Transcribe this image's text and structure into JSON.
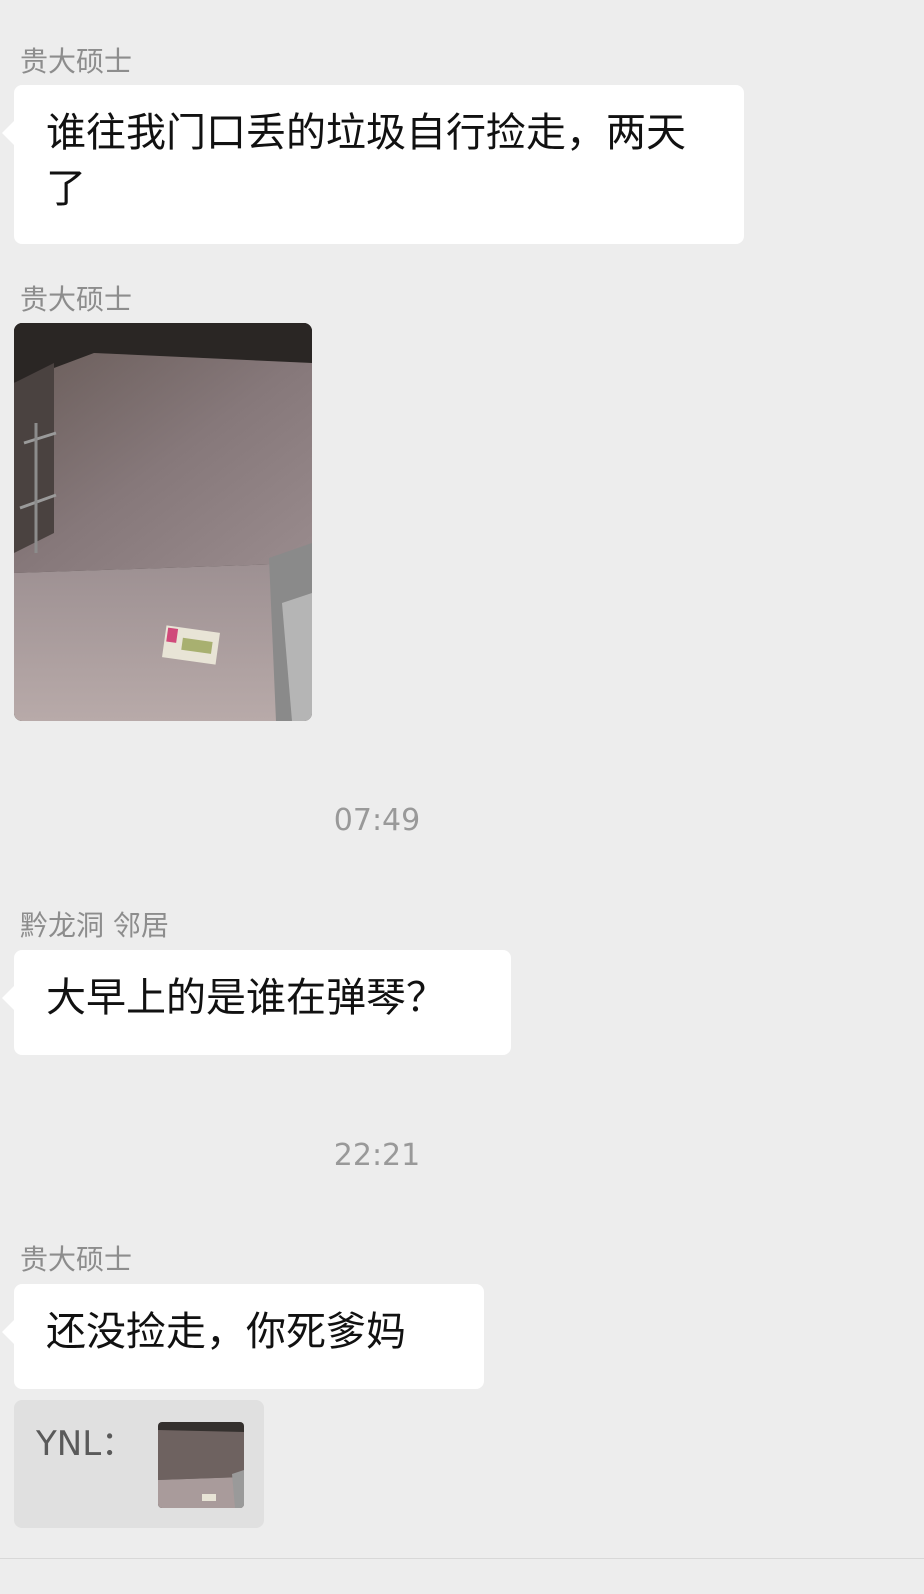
{
  "messages": [
    {
      "sender": "贵大硕士",
      "text": "谁往我门口丢的垃圾自行捡走，两天了"
    },
    {
      "sender": "贵大硕士"
    },
    {
      "time": "07:49"
    },
    {
      "sender": "黔龙洞 邻居",
      "text": "大早上的是谁在弹琴？"
    },
    {
      "time": "22:21"
    },
    {
      "sender": "贵大硕士",
      "text": "还没捡走，你死爹妈"
    }
  ],
  "quote": {
    "label": "YNL："
  }
}
